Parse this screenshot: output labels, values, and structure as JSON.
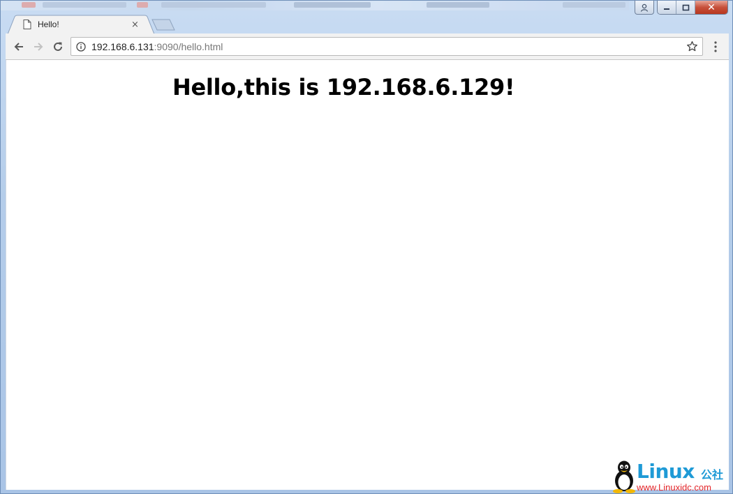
{
  "browser": {
    "tab": {
      "title": "Hello!",
      "close_glyph": "×"
    },
    "omnibox": {
      "host": "192.168.6.131",
      "path": ":9090/hello.html"
    },
    "window_controls": {
      "close_glyph": "✕"
    }
  },
  "page": {
    "heading": "Hello,this is 192.168.6.129!"
  },
  "watermark": {
    "brand": "Linux",
    "suffix": "公社",
    "url": "www.Linuxidc.com"
  },
  "colors": {
    "chrome_frame": "#b4cdea",
    "toolbar": "#f2f2f2",
    "watermark_blue": "#1e9ad6",
    "watermark_red": "#e3262a"
  },
  "icons": [
    "page-icon",
    "close-icon",
    "back-arrow-icon",
    "forward-arrow-icon",
    "reload-icon",
    "info-icon",
    "star-icon",
    "more-vert-icon",
    "user-icon",
    "minimize-icon",
    "maximize-icon",
    "penguin-icon"
  ]
}
